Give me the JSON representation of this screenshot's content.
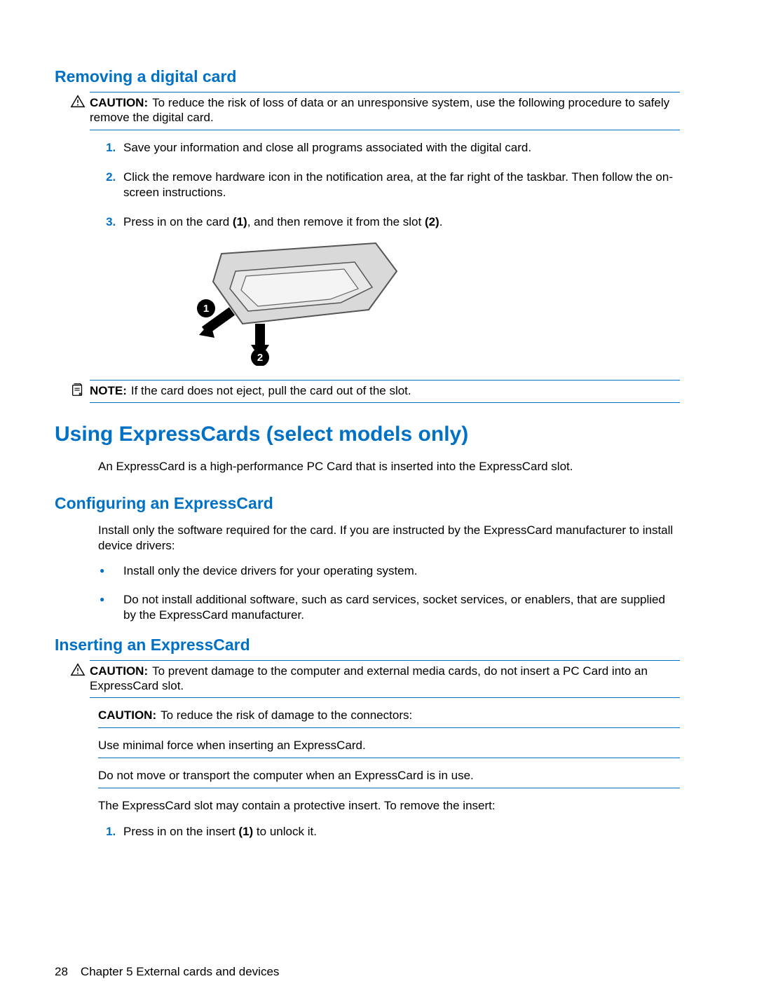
{
  "sections": {
    "removing": {
      "title": "Removing a digital card",
      "caution_label": "CAUTION:",
      "caution_text": "To reduce the risk of loss of data or an unresponsive system, use the following procedure to safely remove the digital card.",
      "step1": "Save your information and close all programs associated with the digital card.",
      "step2": "Click the remove hardware icon in the notification area, at the far right of the taskbar. Then follow the on-screen instructions.",
      "step3_a": "Press in on the card ",
      "step3_b": "(1)",
      "step3_c": ", and then remove it from the slot ",
      "step3_d": "(2)",
      "step3_e": ".",
      "note_label": "NOTE:",
      "note_text": "If the card does not eject, pull the card out of the slot."
    },
    "using": {
      "title": "Using ExpressCards (select models only)",
      "intro": "An ExpressCard is a high-performance PC Card that is inserted into the ExpressCard slot."
    },
    "config": {
      "title": "Configuring an ExpressCard",
      "intro": "Install only the software required for the card. If you are instructed by the ExpressCard manufacturer to install device drivers:",
      "b1": "Install only the device drivers for your operating system.",
      "b2": "Do not install additional software, such as card services, socket services, or enablers, that are supplied by the ExpressCard manufacturer."
    },
    "insert": {
      "title": "Inserting an ExpressCard",
      "caution_label": "CAUTION:",
      "caution1": "To prevent damage to the computer and external media cards, do not insert a PC Card into an ExpressCard slot.",
      "caution2_label": "CAUTION:",
      "caution2": "To reduce the risk of damage to the connectors:",
      "line1": "Use minimal force when inserting an ExpressCard.",
      "line2": "Do not move or transport the computer when an ExpressCard is in use.",
      "body": "The ExpressCard slot may contain a protective insert. To remove the insert:",
      "step1_a": "Press in on the insert ",
      "step1_b": "(1)",
      "step1_c": " to unlock it."
    }
  },
  "footer": {
    "page": "28",
    "chapter": "Chapter 5   External cards and devices"
  }
}
